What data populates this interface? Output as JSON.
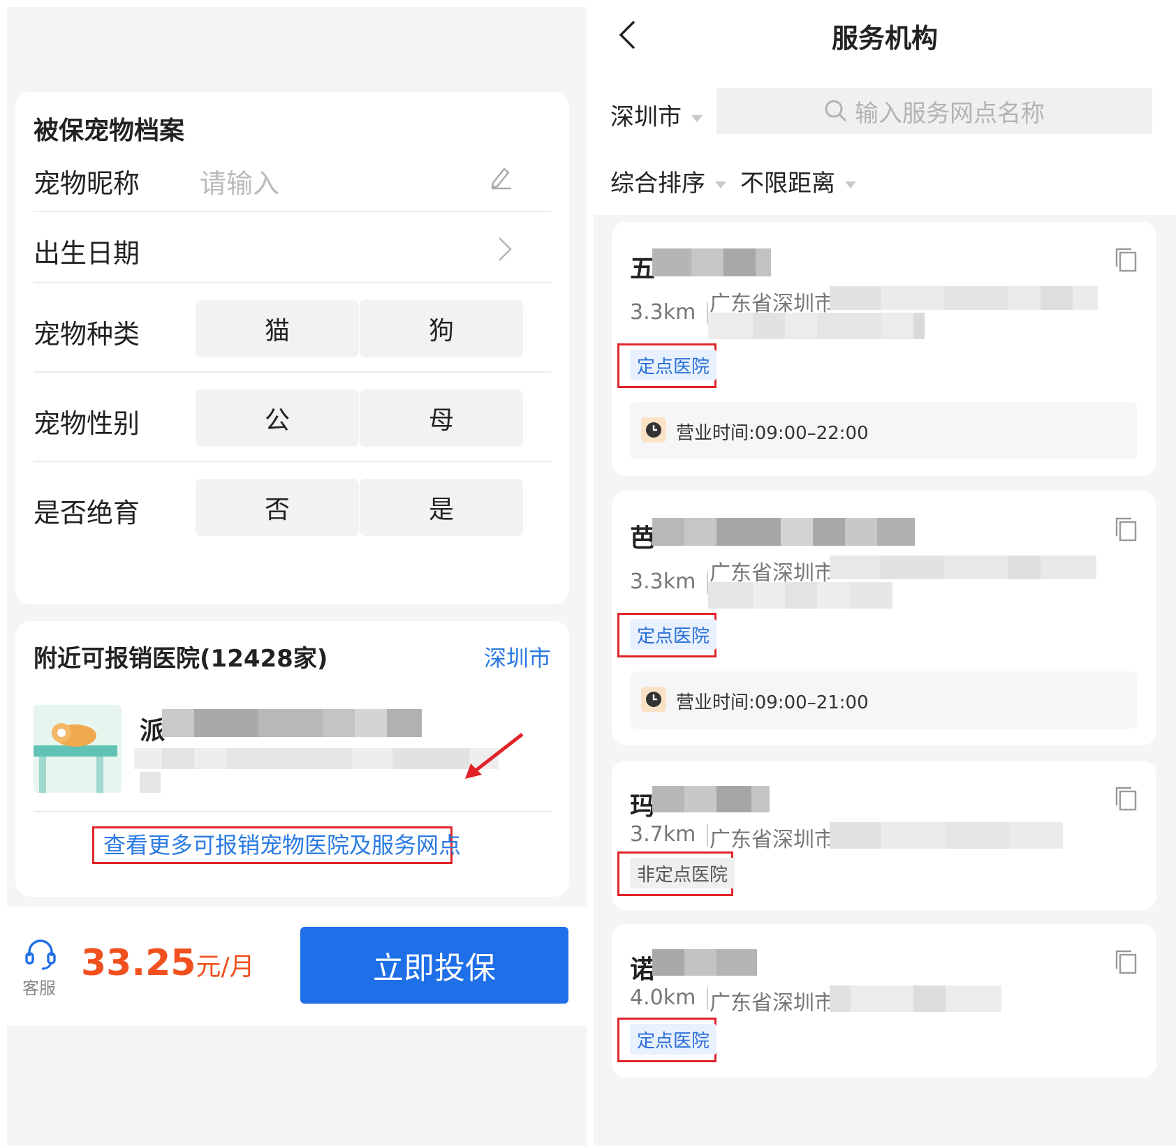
{
  "left": {
    "pet_card": {
      "title": "被保宠物档案",
      "nickname_label": "宠物昵称",
      "nickname_placeholder": "请输入",
      "birth_label": "出生日期",
      "species_label": "宠物种类",
      "species_options": [
        "猫",
        "狗"
      ],
      "gender_label": "宠物性别",
      "gender_options": [
        "公",
        "母"
      ],
      "neutered_label": "是否绝育",
      "neutered_options": [
        "否",
        "是"
      ]
    },
    "hospital_card": {
      "title": "附近可报销医院(12428家)",
      "city_link": "深圳市",
      "hospital_name_initial": "派",
      "more_link": "查看更多可报销宠物医院及服务网点"
    },
    "bottom_bar": {
      "cs_label": "客服",
      "price": "33.25",
      "price_unit": "元/月",
      "buy_label": "立即投保"
    }
  },
  "right": {
    "title": "服务机构",
    "city": "深圳市",
    "search_placeholder": "输入服务网点名称",
    "sort_label": "综合排序",
    "distance_label": "不限距离",
    "hospitals": [
      {
        "name_initial": "五",
        "distance": "3.3km",
        "address_prefix": "广东省深圳市",
        "tag": "定点医院",
        "hours": "营业时间:09:00–22:00"
      },
      {
        "name_initial": "芭",
        "distance": "3.3km",
        "address_prefix": "广东省深圳市",
        "tag": "定点医院",
        "hours": "营业时间:09:00–21:00"
      },
      {
        "name_initial": "玛",
        "distance": "3.7km",
        "address_prefix": "广东省深圳市",
        "tag": "非定点医院"
      },
      {
        "name_initial": "诺",
        "distance": "4.0km",
        "address_prefix": "广东省深圳市",
        "tag": "定点医院"
      }
    ]
  },
  "colors": {
    "accent_blue": "#1f6fe8",
    "link_blue": "#2a7ae2",
    "price_orange": "#f0501e",
    "highlight_red": "#e0242a"
  }
}
